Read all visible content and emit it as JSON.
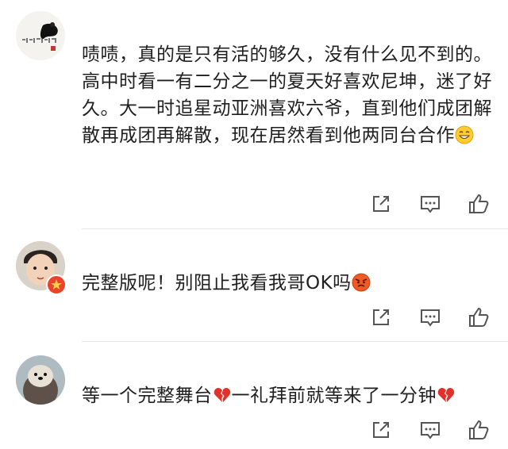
{
  "comments": [
    {
      "avatar_icon": "ink-calligraphy-avatar",
      "text": "啧啧，真的是只有活的够久，没有什么见不到的。高中时看一有二分之一的夏天好喜欢尼坤，迷了好久。大一时追星动亚洲喜欢六爷，直到他们成团解散再成团再解散，现在居然看到他两同台合作",
      "trailing_emoji": "grinning-emoji"
    },
    {
      "avatar_icon": "child-photo-avatar",
      "verified_badge": "verified-star-icon",
      "text": "完整版呢！别阻止我看我哥OK吗",
      "trailing_emoji": "angry-face-emoji"
    },
    {
      "avatar_icon": "otter-photo-avatar",
      "text_parts": [
        "等一个完整舞台",
        "一礼拜前就等来了一分钟"
      ],
      "inline_emoji": "broken-heart-emoji"
    }
  ],
  "actions": [
    "share-icon",
    "comment-icon",
    "like-icon"
  ],
  "colors": {
    "icon": "#555555",
    "badge": "#e8442d",
    "heart": "#e0312b",
    "text": "#1f1f1f"
  }
}
